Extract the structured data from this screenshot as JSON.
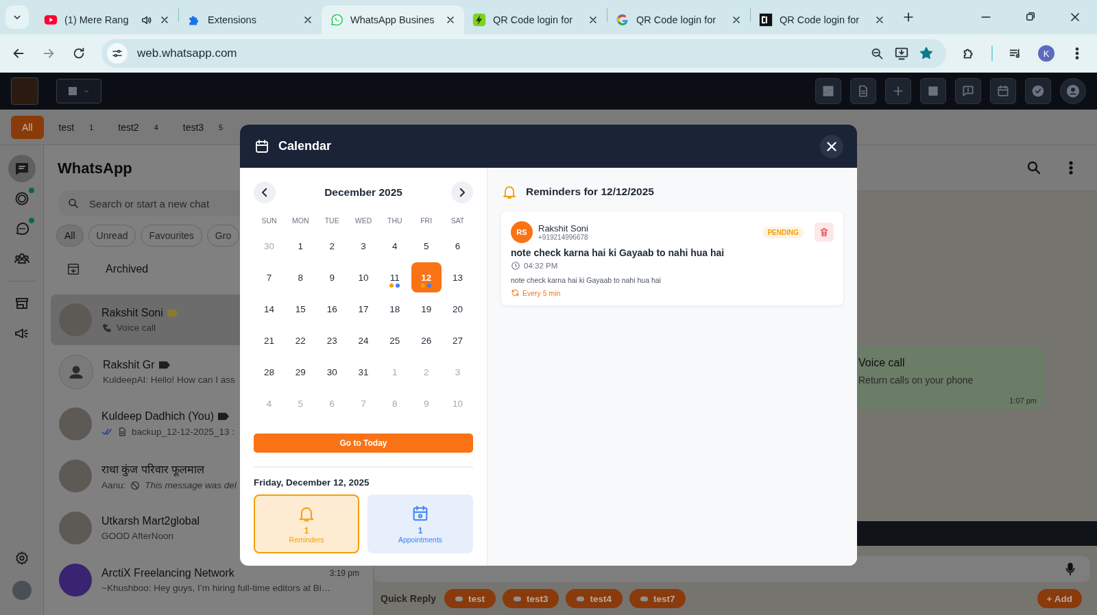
{
  "browser": {
    "tabs": [
      {
        "kind": "video",
        "title": "(1) Mere Rang",
        "audio": true,
        "selected": false
      },
      {
        "kind": "extension",
        "title": "Extensions",
        "audio": false,
        "selected": false
      },
      {
        "kind": "chat",
        "title": "WhatsApp Busines",
        "audio": false,
        "selected": true
      },
      {
        "kind": "bolt",
        "title": "QR Code login for",
        "audio": false,
        "selected": false
      },
      {
        "kind": "search",
        "title": "QR Code login for",
        "audio": false,
        "selected": false
      },
      {
        "kind": "logo",
        "title": "QR Code login for",
        "audio": false,
        "selected": false
      }
    ],
    "address": "web.whatsapp.com",
    "bookmarked": true,
    "profile_initial": "K"
  },
  "labels": [
    {
      "label": "All",
      "selected": true
    },
    {
      "label": "test",
      "count": "1",
      "selected": false
    },
    {
      "label": "test2",
      "count": "4",
      "selected": false
    },
    {
      "label": "test3",
      "count": "5",
      "selected": false
    }
  ],
  "nav_top": [
    {
      "kind": "chats",
      "selected": true,
      "unread": false
    },
    {
      "kind": "status",
      "selected": false,
      "unread": true
    },
    {
      "kind": "channels",
      "selected": false,
      "unread": true
    },
    {
      "kind": "communities",
      "selected": false,
      "unread": false
    }
  ],
  "nav_tools": [
    {
      "kind": "catalog",
      "selected": false
    },
    {
      "kind": "broadcast",
      "selected": false
    }
  ],
  "chat_list": {
    "title": "WhatsApp",
    "search_placeholder": "Search or start a new chat",
    "filters": [
      {
        "label": "All",
        "selected": true
      },
      {
        "label": "Unread",
        "selected": false
      },
      {
        "label": "Favourites",
        "selected": false
      },
      {
        "label": "Gro",
        "selected": false
      }
    ],
    "archived": "Archived",
    "chats": [
      {
        "name": "Rakshit Soni",
        "kind": "photo",
        "color": "#8a7a2e",
        "selected": true,
        "preview": {
          "kind": "call",
          "text": "Voice call"
        }
      },
      {
        "name": "Rakshit Gr",
        "kind": "default",
        "color": "#1b1f24",
        "selected": false,
        "preview": {
          "kind": "text",
          "text": "KuldeepAI: Hello! How can I ass"
        }
      },
      {
        "name": "Kuldeep Dadhich (You)",
        "kind": "photo",
        "color": "#1b1f24",
        "selected": false,
        "preview": {
          "kind": "document",
          "text": "backup_12-12-2025_13 :"
        }
      },
      {
        "name": "राधा कुंज परिवार फूलमाल",
        "kind": "photo",
        "selected": false,
        "preview": {
          "kind": "deleted",
          "sender": "Aanu:",
          "text": "This message was del"
        }
      },
      {
        "name": "Utkarsh Mart2global",
        "kind": "photo",
        "selected": false,
        "preview": {
          "kind": "text",
          "text": "GOOD AfterNoon"
        }
      },
      {
        "name": "ArctiX Freelancing Network",
        "kind": "logo",
        "selected": false,
        "time": "3:19 pm",
        "preview": {
          "kind": "text",
          "text": "~Khushboo: Hey guys, I’m hiring full-time editors at Bi…"
        }
      }
    ]
  },
  "conversation": {
    "message": {
      "title": "Voice call",
      "subtitle": "Return calls on your phone",
      "time": "1:07 pm"
    },
    "quick_reply": {
      "label": "Quick Reply",
      "chips": [
        "test",
        "test3",
        "test4",
        "test7"
      ],
      "add": "+ Add"
    }
  },
  "calendar": {
    "title": "Calendar",
    "month": "December 2025",
    "weekdays": [
      "SUN",
      "MON",
      "TUE",
      "WED",
      "THU",
      "FRI",
      "SAT"
    ],
    "days": [
      {
        "label": "30",
        "outside_month": true,
        "selected": false
      },
      {
        "label": "1",
        "outside_month": false,
        "selected": false
      },
      {
        "label": "2",
        "outside_month": false,
        "selected": false
      },
      {
        "label": "3",
        "outside_month": false,
        "selected": false
      },
      {
        "label": "4",
        "outside_month": false,
        "selected": false
      },
      {
        "label": "5",
        "outside_month": false,
        "selected": false
      },
      {
        "label": "6",
        "outside_month": false,
        "selected": false
      },
      {
        "label": "7",
        "outside_month": false,
        "selected": false
      },
      {
        "label": "8",
        "outside_month": false,
        "selected": false
      },
      {
        "label": "9",
        "outside_month": false,
        "selected": false
      },
      {
        "label": "10",
        "outside_month": false,
        "selected": false
      },
      {
        "label": "11",
        "outside_month": false,
        "selected": false,
        "dots": [
          {
            "color": "#f59e0b"
          },
          {
            "color": "#3b82f6"
          }
        ]
      },
      {
        "label": "12",
        "outside_month": false,
        "selected": true,
        "dots": [
          {
            "color": "#f59e0b"
          },
          {
            "color": "#3b82f6"
          }
        ]
      },
      {
        "label": "13",
        "outside_month": false,
        "selected": false
      },
      {
        "label": "14",
        "outside_month": false,
        "selected": false
      },
      {
        "label": "15",
        "outside_month": false,
        "selected": false
      },
      {
        "label": "16",
        "outside_month": false,
        "selected": false
      },
      {
        "label": "17",
        "outside_month": false,
        "selected": false
      },
      {
        "label": "18",
        "outside_month": false,
        "selected": false
      },
      {
        "label": "19",
        "outside_month": false,
        "selected": false
      },
      {
        "label": "20",
        "outside_month": false,
        "selected": false
      },
      {
        "label": "21",
        "outside_month": false,
        "selected": false
      },
      {
        "label": "22",
        "outside_month": false,
        "selected": false
      },
      {
        "label": "23",
        "outside_month": false,
        "selected": false
      },
      {
        "label": "24",
        "outside_month": false,
        "selected": false
      },
      {
        "label": "25",
        "outside_month": false,
        "selected": false
      },
      {
        "label": "26",
        "outside_month": false,
        "selected": false
      },
      {
        "label": "27",
        "outside_month": false,
        "selected": false
      },
      {
        "label": "28",
        "outside_month": false,
        "selected": false
      },
      {
        "label": "29",
        "outside_month": false,
        "selected": false
      },
      {
        "label": "30",
        "outside_month": false,
        "selected": false
      },
      {
        "label": "31",
        "outside_month": false,
        "selected": false
      },
      {
        "label": "1",
        "outside_month": true,
        "selected": false
      },
      {
        "label": "2",
        "outside_month": true,
        "selected": false
      },
      {
        "label": "3",
        "outside_month": true,
        "selected": false
      },
      {
        "label": "4",
        "outside_month": true,
        "selected": false
      },
      {
        "label": "5",
        "outside_month": true,
        "selected": false
      },
      {
        "label": "6",
        "outside_month": true,
        "selected": false
      },
      {
        "label": "7",
        "outside_month": true,
        "selected": false
      },
      {
        "label": "8",
        "outside_month": true,
        "selected": false
      },
      {
        "label": "9",
        "outside_month": true,
        "selected": false
      },
      {
        "label": "10",
        "outside_month": true,
        "selected": false
      }
    ],
    "today_button": "Go to Today",
    "date_heading": "Friday, December 12, 2025",
    "summary": [
      {
        "kind": "reminders",
        "count": "1",
        "label": "Reminders",
        "selected": true
      },
      {
        "kind": "appointments",
        "count": "1",
        "label": "Appointments",
        "selected": false
      }
    ],
    "reminders": {
      "heading": "Reminders for 12/12/2025",
      "items": [
        {
          "initials": "RS",
          "name": "Rakshit Soni",
          "phone": "+919214996678",
          "status": "PENDING",
          "title": "note check karna hai ki Gayaab to nahi hua hai",
          "time": "04:32 PM",
          "note": "note check karna hai ki Gayaab to nahi hua hai",
          "repeat": "Every 5 min"
        }
      ]
    }
  }
}
